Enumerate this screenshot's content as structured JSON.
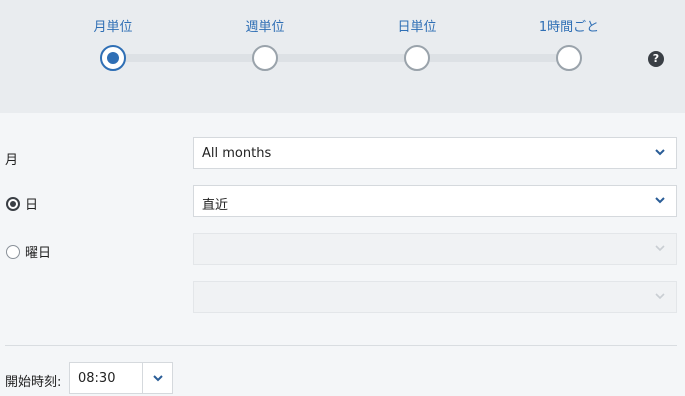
{
  "frequency": {
    "steps": [
      {
        "label": "月単位",
        "active": true
      },
      {
        "label": "週単位",
        "active": false
      },
      {
        "label": "日単位",
        "active": false
      },
      {
        "label": "1時間ごと",
        "active": false
      }
    ],
    "help_icon": "question-circle-icon",
    "help_glyph": "?"
  },
  "form": {
    "month_label": "月",
    "month_select_value": "All months",
    "day_label": "日",
    "day_select_value": "直近",
    "day_radio_checked": true,
    "weekday_label": "曜日",
    "weekday_radio_checked": false,
    "weekday_select_value": "",
    "weekday_select2_value": ""
  },
  "time": {
    "label": "開始時刻:",
    "value": "08:30"
  },
  "colors": {
    "accent": "#2f6fb5",
    "header_bg": "#e9ecef",
    "page_bg": "#f4f6f8"
  }
}
